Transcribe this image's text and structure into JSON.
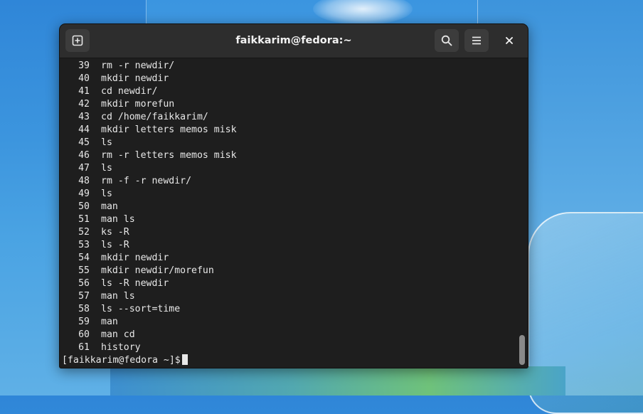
{
  "window": {
    "title": "faikkarim@fedora:~"
  },
  "titlebar": {
    "icons": {
      "new_tab": "new-tab-icon",
      "search": "search-icon",
      "menu": "hamburger-menu-icon",
      "close": "close-icon"
    }
  },
  "terminal": {
    "history": [
      {
        "num": "39",
        "cmd": "rm -r newdir/"
      },
      {
        "num": "40",
        "cmd": "mkdir newdir"
      },
      {
        "num": "41",
        "cmd": "cd newdir/"
      },
      {
        "num": "42",
        "cmd": "mkdir morefun"
      },
      {
        "num": "43",
        "cmd": "cd /home/faikkarim/"
      },
      {
        "num": "44",
        "cmd": "mkdir letters memos misk"
      },
      {
        "num": "45",
        "cmd": "ls"
      },
      {
        "num": "46",
        "cmd": "rm -r letters memos misk"
      },
      {
        "num": "47",
        "cmd": "ls"
      },
      {
        "num": "48",
        "cmd": "rm -f -r newdir/"
      },
      {
        "num": "49",
        "cmd": "ls"
      },
      {
        "num": "50",
        "cmd": "man"
      },
      {
        "num": "51",
        "cmd": "man ls"
      },
      {
        "num": "52",
        "cmd": "ks -R"
      },
      {
        "num": "53",
        "cmd": "ls -R"
      },
      {
        "num": "54",
        "cmd": "mkdir newdir"
      },
      {
        "num": "55",
        "cmd": "mkdir newdir/morefun"
      },
      {
        "num": "56",
        "cmd": "ls -R newdir"
      },
      {
        "num": "57",
        "cmd": "man ls"
      },
      {
        "num": "58",
        "cmd": "ls --sort=time"
      },
      {
        "num": "59",
        "cmd": "man"
      },
      {
        "num": "60",
        "cmd": "man cd"
      },
      {
        "num": "61",
        "cmd": "history"
      }
    ],
    "prompt": "[faikkarim@fedora ~]$"
  },
  "colors": {
    "terminal_bg": "#1e1e1e",
    "titlebar_bg": "#2d2d2d",
    "text": "#e8e8e8"
  }
}
